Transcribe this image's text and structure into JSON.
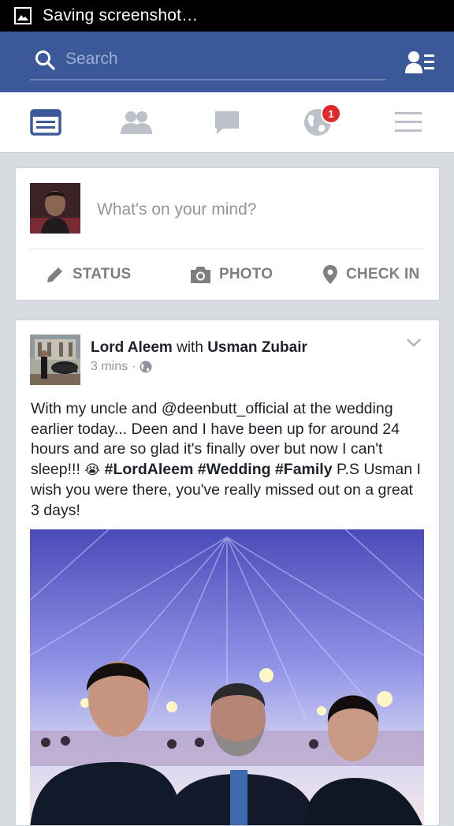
{
  "status_bar": {
    "text": "Saving screenshot…"
  },
  "search": {
    "placeholder": "Search"
  },
  "nav": {
    "notifications_badge": "1",
    "tabs": [
      "News Feed",
      "Friends",
      "Messages",
      "Notifications",
      "More"
    ]
  },
  "composer": {
    "prompt": "What's on your mind?",
    "actions": {
      "status": "STATUS",
      "photo": "PHOTO",
      "checkin": "CHECK IN"
    }
  },
  "post": {
    "author": "Lord Aleem",
    "with_word": "with",
    "tagged": "Usman Zubair",
    "time": "3 mins",
    "separator": "·",
    "text_part1": "With my uncle and @deenbutt_official at the wedding earlier today... Deen and I have been up for around 24 hours and are so glad it's finally over but now I can't sleep!!! ",
    "emoji": "😭",
    "tags": [
      "#LordAleem",
      "#Wedding",
      "#Family"
    ],
    "text_part2": " P.S Usman I wish you were there, you've really missed out on a great 3 days!"
  },
  "colors": {
    "brand": "#3b5998",
    "badge": "#e02a2a",
    "icon_inactive": "#bdc1c9"
  }
}
